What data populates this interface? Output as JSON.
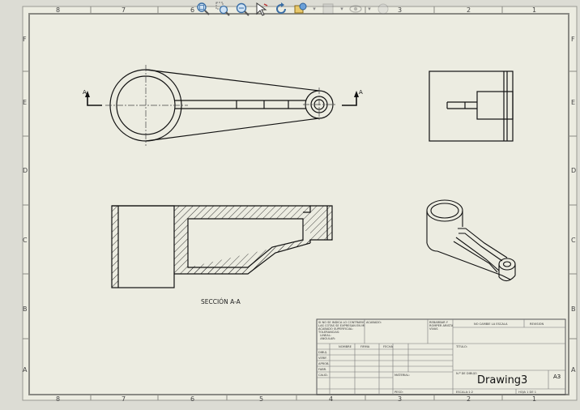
{
  "zones": {
    "columns": [
      "8",
      "7",
      "6",
      "5",
      "4",
      "3",
      "2",
      "1"
    ],
    "rows": [
      "F",
      "E",
      "D",
      "C",
      "B",
      "A"
    ]
  },
  "toolbar": {
    "items": [
      {
        "name": "zoom-to-fit-icon"
      },
      {
        "name": "zoom-to-area-icon"
      },
      {
        "name": "zoom-in-out-icon"
      },
      {
        "name": "select-icon"
      },
      {
        "name": "rotate-view-icon"
      },
      {
        "name": "view-settings-icon"
      },
      {
        "name": "display-style-icon"
      },
      {
        "name": "hide-show-icon"
      },
      {
        "name": "appearance-icon"
      }
    ]
  },
  "views": {
    "section_marker": "A",
    "section_label": "SECCIÓN A-A"
  },
  "title_block": {
    "notes_left": "SI NO SE INDICA LO CONTRARIO:\nLAS COTAS SE EXPRESAN EN MM\nACABADO SUPERFICIAL:\nTOLERANCIAS:\n  LINEAL:\n  ANGULAR:",
    "finish_label": "ACABADO:",
    "edges_label": "REBARBAR Y\nROMPER ARISTAS\nVIVAS",
    "nochange_label": "NO CAMBIE LA ESCALA",
    "revision_label": "REVISIÓN",
    "title_label": "TÍTULO:",
    "cols": [
      "NOMBRE",
      "FIRMA",
      "FECHA"
    ],
    "rows": [
      "DIBUJ.",
      "VERIF.",
      "APROB.",
      "FABR.",
      "CALID."
    ],
    "material_label": "MATERIAL:",
    "peso_label": "PESO:",
    "drawing_no_label": "N.º DE DIBUJO",
    "drawing_name": "Drawing3",
    "size": "A3",
    "scale_label": "ESCALA:1:2",
    "sheet_label": "HOJA 1 DE 1"
  }
}
